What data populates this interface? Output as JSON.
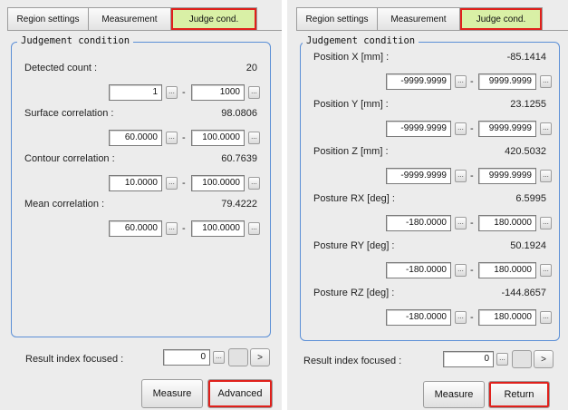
{
  "left": {
    "tabs": [
      {
        "label": "Region settings",
        "name": "tab-region-settings"
      },
      {
        "label": "Measurement",
        "name": "tab-measurement"
      },
      {
        "label": "Judge cond.",
        "name": "tab-judge-cond"
      }
    ],
    "group_title": "Judgement condition",
    "items": [
      {
        "label": "Detected count :",
        "value": "20",
        "min": "1",
        "max": "1000"
      },
      {
        "label": "Surface correlation :",
        "value": "98.0806",
        "min": "60.0000",
        "max": "100.0000"
      },
      {
        "label": "Contour correlation :",
        "value": "60.7639",
        "min": "10.0000",
        "max": "100.0000"
      },
      {
        "label": "Mean correlation :",
        "value": "79.4222",
        "min": "60.0000",
        "max": "100.0000"
      }
    ],
    "result_index_label": "Result index focused :",
    "result_index_value": "0",
    "measure_label": "Measure",
    "action_label": "Advanced"
  },
  "right": {
    "tabs": [
      {
        "label": "Region settings",
        "name": "tab-region-settings"
      },
      {
        "label": "Measurement",
        "name": "tab-measurement"
      },
      {
        "label": "Judge cond.",
        "name": "tab-judge-cond"
      }
    ],
    "group_title": "Judgement condition",
    "items": [
      {
        "label": "Position X [mm] :",
        "value": "-85.1414",
        "min": "-9999.9999",
        "max": "9999.9999"
      },
      {
        "label": "Position Y [mm] :",
        "value": "23.1255",
        "min": "-9999.9999",
        "max": "9999.9999"
      },
      {
        "label": "Position Z [mm] :",
        "value": "420.5032",
        "min": "-9999.9999",
        "max": "9999.9999"
      },
      {
        "label": "Posture RX [deg] :",
        "value": "6.5995",
        "min": "-180.0000",
        "max": "180.0000"
      },
      {
        "label": "Posture RY [deg] :",
        "value": "50.1924",
        "min": "-180.0000",
        "max": "180.0000"
      },
      {
        "label": "Posture RZ [deg] :",
        "value": "-144.8657",
        "min": "-180.0000",
        "max": "180.0000"
      }
    ],
    "result_index_label": "Result index focused :",
    "result_index_value": "0",
    "measure_label": "Measure",
    "action_label": "Return"
  },
  "symbols": {
    "ellipsis": "...",
    "dash": "-",
    "prev": "<",
    "next": ">"
  }
}
